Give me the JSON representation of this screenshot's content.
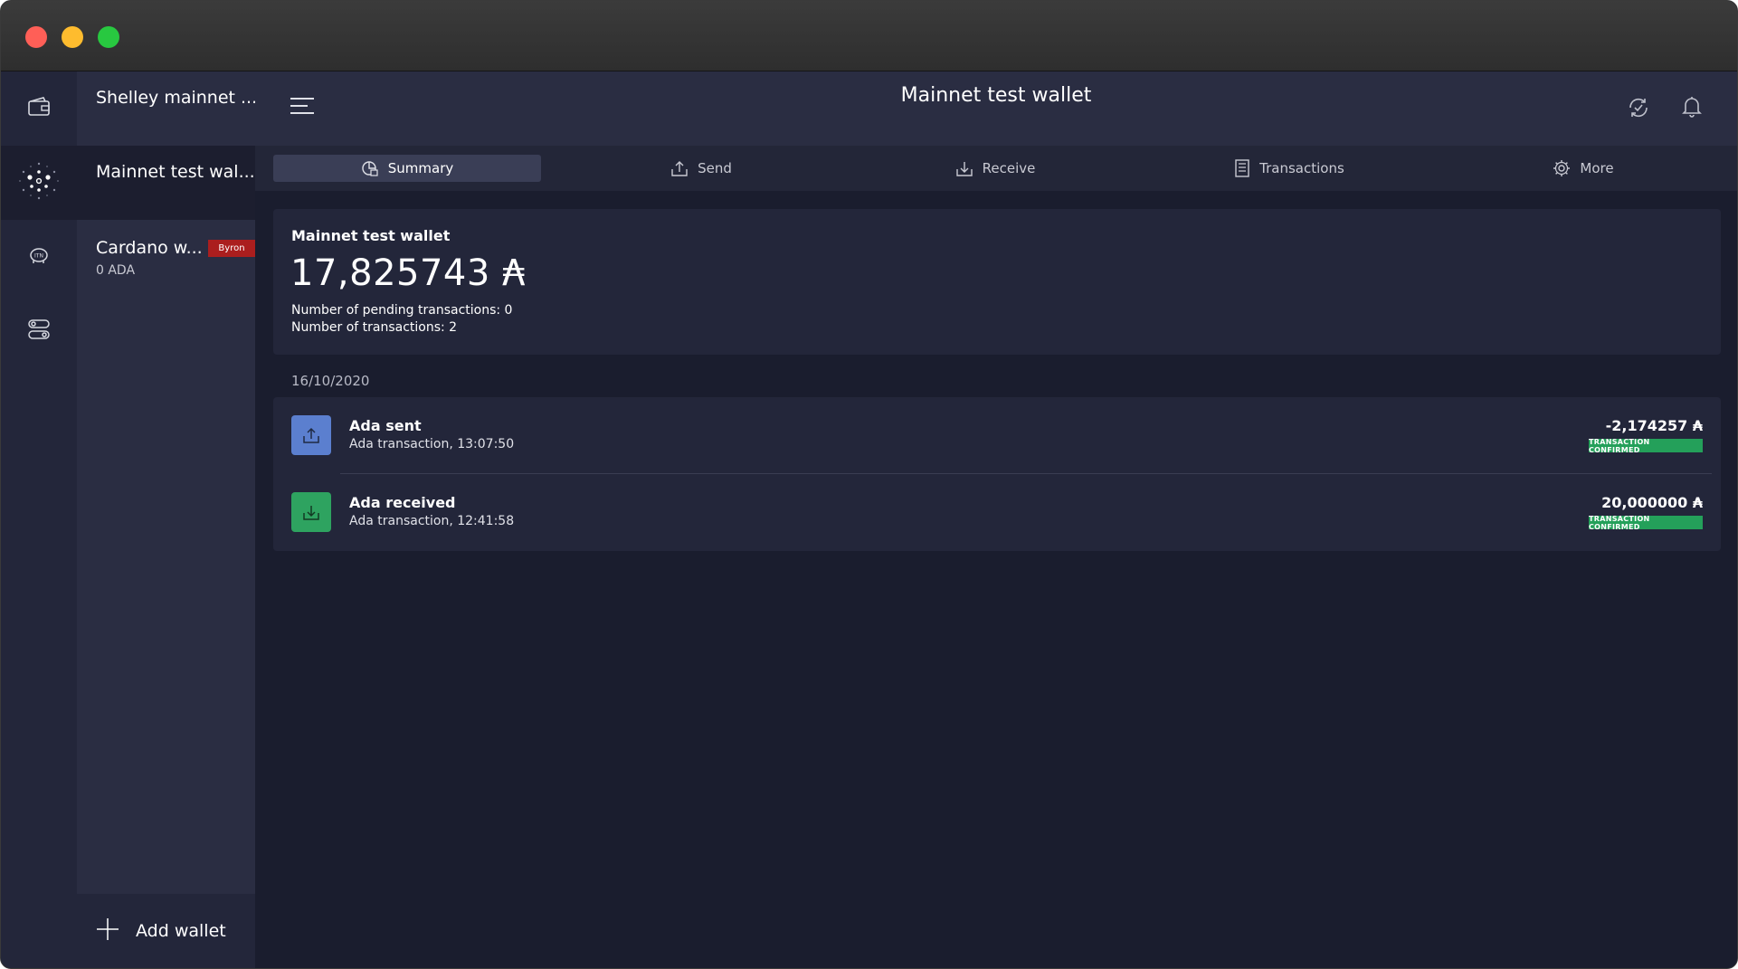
{
  "window": {
    "sidebar_wallets": [
      {
        "name": "Shelley mainnet ...",
        "balance": "",
        "badge": ""
      },
      {
        "name": "Mainnet test wal...",
        "balance": "",
        "badge": ""
      },
      {
        "name": "Cardano w...",
        "balance": "0 ADA",
        "badge": "Byron"
      }
    ],
    "add_wallet_label": "Add wallet"
  },
  "header": {
    "title": "Mainnet test wallet"
  },
  "tabs": [
    {
      "label": "Summary",
      "icon": "summary-icon"
    },
    {
      "label": "Send",
      "icon": "send-icon"
    },
    {
      "label": "Receive",
      "icon": "receive-icon"
    },
    {
      "label": "Transactions",
      "icon": "transactions-icon"
    },
    {
      "label": "More",
      "icon": "gear-icon"
    }
  ],
  "summary": {
    "wallet_name": "Mainnet test wallet",
    "balance": "17,825743 ₳",
    "pending_label": "Number of pending transactions: 0",
    "count_label": "Number of transactions: 2"
  },
  "transactions": {
    "date": "16/10/2020",
    "items": [
      {
        "title": "Ada sent",
        "subtitle": "Ada transaction, 13:07:50",
        "amount": "-2,174257 ₳",
        "status": "TRANSACTION CONFIRMED",
        "icon_color": "#5b7fcf"
      },
      {
        "title": "Ada received",
        "subtitle": "Ada transaction, 12:41:58",
        "amount": "20,000000 ₳",
        "status": "TRANSACTION CONFIRMED",
        "icon_color": "#2ea360"
      }
    ]
  },
  "colors": {
    "accent_green": "#24a05a",
    "byron_badge": "#ab1e1e",
    "background": "#1a1d2e"
  }
}
